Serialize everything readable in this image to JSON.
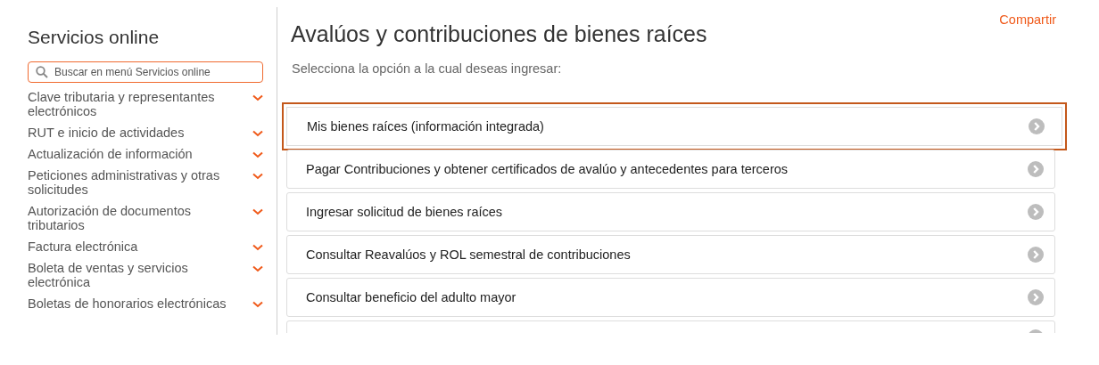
{
  "sidebar": {
    "title": "Servicios online",
    "search": {
      "placeholder": "Buscar en menú Servicios online"
    },
    "items": [
      {
        "label": "Clave tributaria y representantes electrónicos",
        "expanded": false
      },
      {
        "label": "RUT e inicio de actividades",
        "expanded": false
      },
      {
        "label": "Actualización de información",
        "expanded": false
      },
      {
        "label": "Peticiones administrativas y otras solicitudes",
        "expanded": false
      },
      {
        "label": "Autorización de documentos tributarios",
        "expanded": false
      },
      {
        "label": "Factura electrónica",
        "expanded": false
      },
      {
        "label": "Boleta de ventas y servicios electrónica",
        "expanded": false
      },
      {
        "label": "Boletas de honorarios electrónicas",
        "expanded": false
      }
    ]
  },
  "main": {
    "title": "Avalúos y contribuciones de bienes raíces",
    "share_link": "Compartir",
    "subtitle": "Selecciona la opción a la cual deseas ingresar:",
    "options": [
      {
        "kind": "option",
        "label": "Mis bienes raíces (información integrada)",
        "selected": true
      },
      {
        "kind": "option",
        "label": "Pagar Contribuciones y obtener certificados de avalúo y antecedentes para terceros",
        "selected": false
      },
      {
        "kind": "option",
        "label": "Ingresar solicitud de bienes raíces",
        "selected": false
      },
      {
        "kind": "option",
        "label": "Consultar Reavalúos y ROL semestral de contribuciones",
        "selected": false
      },
      {
        "kind": "option",
        "label": "Consultar beneficio del adulto mayor",
        "selected": false
      },
      {
        "kind": "cut",
        "selected": false
      }
    ]
  }
}
